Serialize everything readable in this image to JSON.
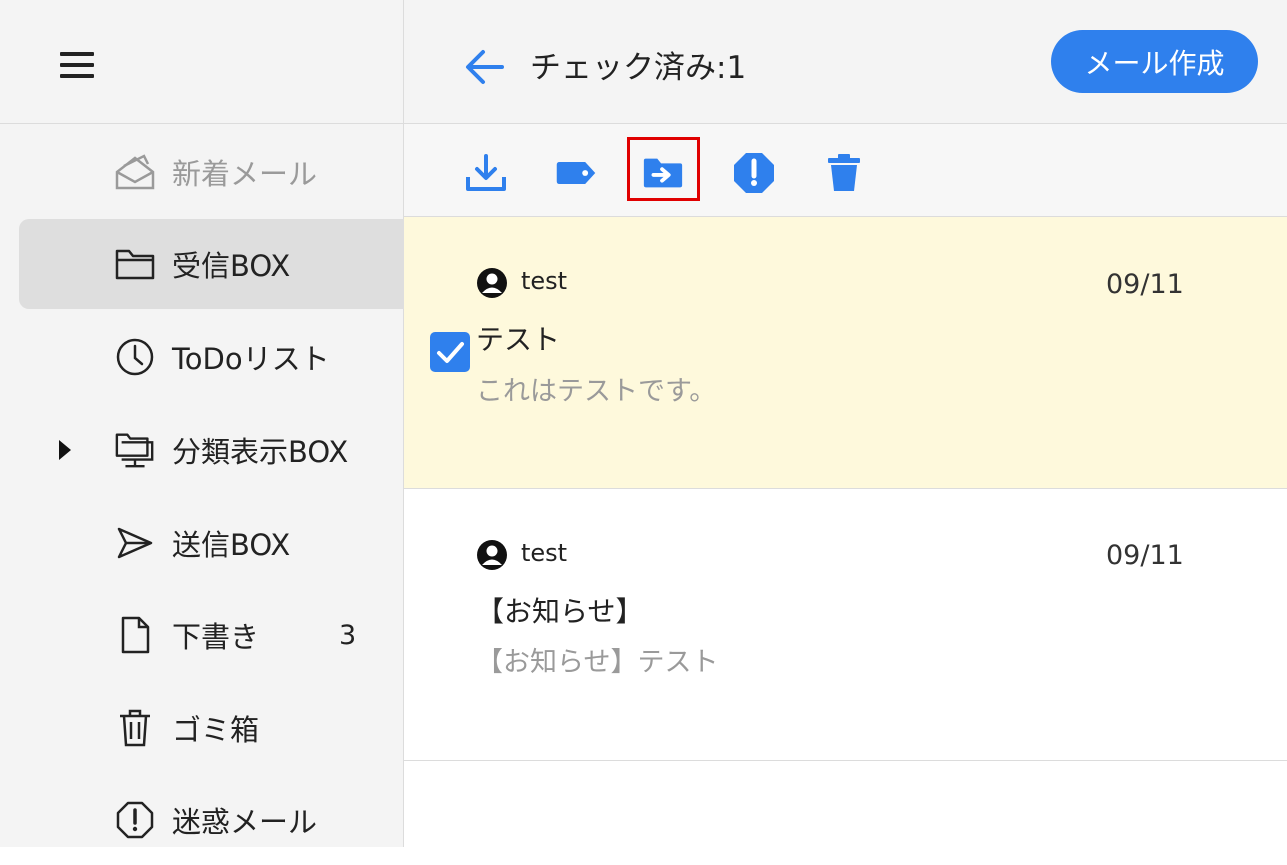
{
  "sidebar": {
    "items": [
      {
        "label": "新着メール",
        "icon": "envelope-open-icon",
        "state": "disabled"
      },
      {
        "label": "受信BOX",
        "icon": "folder-icon",
        "state": "active"
      },
      {
        "label": "ToDoリスト",
        "icon": "clock-icon"
      },
      {
        "label": "分類表示BOX",
        "icon": "folder-tree-icon"
      },
      {
        "label": "送信BOX",
        "icon": "send-icon"
      },
      {
        "label": "下書き",
        "icon": "file-icon",
        "count": "3"
      },
      {
        "label": "ゴミ箱",
        "icon": "trash-icon"
      },
      {
        "label": "迷惑メール",
        "icon": "alert-octagon-icon"
      }
    ]
  },
  "header": {
    "title": "チェック済み:1",
    "compose_label": "メール作成"
  },
  "toolbar": {
    "actions": [
      "download-icon",
      "label-tag-icon",
      "move-to-folder-icon",
      "spam-report-icon",
      "delete-icon"
    ],
    "highlighted": "move-to-folder-icon"
  },
  "mails": [
    {
      "sender": "test",
      "date": "09/11",
      "subject": "テスト",
      "preview": "これはテストです。",
      "checked": true
    },
    {
      "sender": "test",
      "date": "09/11",
      "subject": "【お知らせ】",
      "preview": "【お知らせ】テスト",
      "checked": false
    }
  ],
  "colors": {
    "accent": "#2f80ed",
    "selected_row": "#fef9dc",
    "highlight_box": "#e00000"
  }
}
